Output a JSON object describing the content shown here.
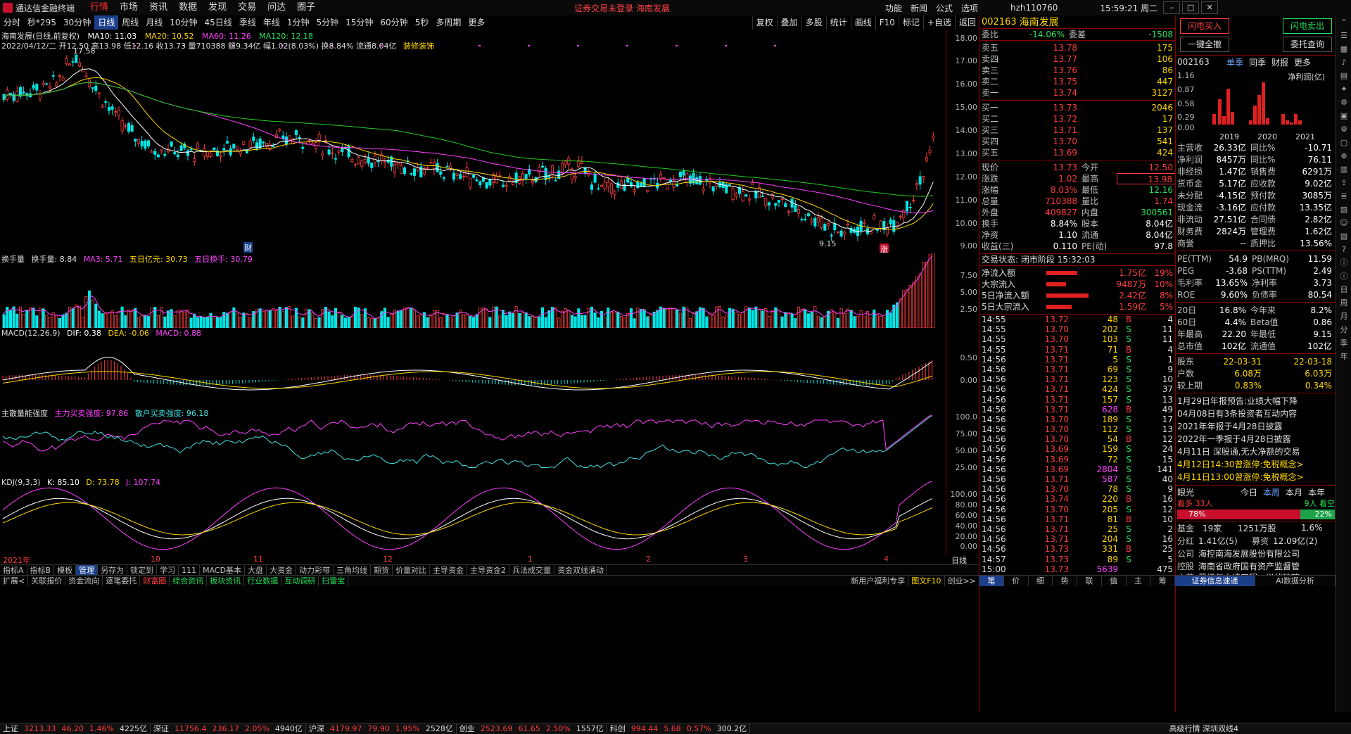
{
  "app": {
    "title": "通达信金融终端",
    "menu": [
      "行情",
      "市场",
      "资讯",
      "数据",
      "发现",
      "交易",
      "问达",
      "圈子"
    ],
    "active_menu": "行情",
    "notice": "证券交易未登录  海南发展",
    "right_menu": [
      "功能",
      "新闻",
      "公式",
      "选项"
    ],
    "user": "hzh110760",
    "time": "15:59:21 周二"
  },
  "periods": [
    "分时",
    "秒*295",
    "30分钟",
    "日线",
    "周线",
    "月线",
    "10分钟",
    "45日线",
    "季线",
    "年线",
    "1分钟",
    "5分钟",
    "15分钟",
    "60分钟",
    "5秒",
    "多周期",
    "更多"
  ],
  "active_period": "日线",
  "period_tools": [
    "复权",
    "叠加",
    "多股",
    "统计",
    "画线",
    "F10",
    "标记",
    "+自选",
    "返回"
  ],
  "price_panel": {
    "title": "海南发展(日线,前复权)",
    "ma10": "MA10: 11.03",
    "ma20": "MA20: 10.52",
    "ma60": "MA60: 11.26",
    "ma120": "MA120: 12.18",
    "info": "2022/04/12/二  开12.50 高13.98 低12.16 收13.73 量710388 额9.34亿 幅1.02(8.03%) 换8.84% 流通8.04亿",
    "sector": "装修装饰",
    "high_mark": "17.58",
    "low_mark": "9.15",
    "fin_mark": "财",
    "zhang_mark": "涨",
    "axis": [
      "18.00",
      "17.00",
      "16.00",
      "15.00",
      "14.00",
      "13.00",
      "12.00",
      "11.00",
      "10.00",
      "9.00"
    ]
  },
  "volume_panel": {
    "title": "换手量",
    "v1": "换手量: 8.84",
    "v2": "MA3: 5.71",
    "v3": "五日亿元: 30.73",
    "v4": "五日换手: 30.79",
    "axis": [
      "7.50",
      "5.00",
      "2.50"
    ]
  },
  "macd_panel": {
    "title": "MACD(12,26,9)",
    "dif": "DIF: 0.38",
    "dea": "DEA: -0.06",
    "macd": "MACD: 0.88",
    "axis": [
      "0.50",
      "0.00"
    ]
  },
  "strength_panel": {
    "title": "主散量能强度",
    "v1": "主力买卖强度: 97.86",
    "v2": "散户买卖强度: 96.18",
    "axis": [
      "100.0",
      "75.00",
      "50.00",
      "25.00"
    ]
  },
  "kdj_panel": {
    "title": "KDJ(9,3,3)",
    "k": "K: 85.10",
    "d": "D: 73.78",
    "j": "J: 107.74",
    "axis": [
      "100.00",
      "80.00",
      "60.00",
      "40.00",
      "20.00",
      "0.00"
    ]
  },
  "x_axis": {
    "labels": [
      "2021年",
      "10",
      "11",
      "12",
      "1",
      "2",
      "3",
      "4"
    ],
    "unit": "日线"
  },
  "quote": {
    "code": "002163",
    "name": "海南发展",
    "wb_label": "委比",
    "wb": "-14.06%",
    "wc_label": "委差",
    "wc": "-1508",
    "asks": [
      {
        "label": "卖五",
        "price": "13.78",
        "vol": "175"
      },
      {
        "label": "卖四",
        "price": "13.77",
        "vol": "106"
      },
      {
        "label": "卖三",
        "price": "13.76",
        "vol": "86"
      },
      {
        "label": "卖二",
        "price": "13.75",
        "vol": "447"
      },
      {
        "label": "卖一",
        "price": "13.74",
        "vol": "3127"
      }
    ],
    "bids": [
      {
        "label": "买一",
        "price": "13.73",
        "vol": "2046"
      },
      {
        "label": "买二",
        "price": "13.72",
        "vol": "17"
      },
      {
        "label": "买三",
        "price": "13.71",
        "vol": "137"
      },
      {
        "label": "买四",
        "price": "13.70",
        "vol": "541"
      },
      {
        "label": "买五",
        "price": "13.69",
        "vol": "424"
      }
    ],
    "stats": [
      {
        "l1": "现价",
        "v1": "13.73",
        "l2": "今开",
        "v2": "12.50"
      },
      {
        "l1": "涨跌",
        "v1": "1.02",
        "l2": "最高",
        "v2": "13.98"
      },
      {
        "l1": "涨幅",
        "v1": "8.03%",
        "l2": "最低",
        "v2": "12.16"
      },
      {
        "l1": "总量",
        "v1": "710388",
        "l2": "量比",
        "v2": "1.74"
      },
      {
        "l1": "外盘",
        "v1": "409827",
        "l2": "内盘",
        "v2": "300561"
      },
      {
        "l1": "换手",
        "v1": "8.84%",
        "l2": "股本",
        "v2": "8.04亿"
      },
      {
        "l1": "净资",
        "v1": "1.10",
        "l2": "流通",
        "v2": "8.04亿"
      },
      {
        "l1": "收益(三)",
        "v1": "0.110",
        "l2": "PE(动)",
        "v2": "97.8"
      }
    ],
    "trade_status": "交易状态: 闭市阶段 15:32:03",
    "flows": [
      {
        "label": "净流入额",
        "val": "1.75亿",
        "pct": "19%",
        "bar": 0.55
      },
      {
        "label": "大宗流入",
        "val": "9487万",
        "pct": "10%",
        "bar": 0.35
      },
      {
        "label": "5日净流入额",
        "val": "2.42亿",
        "pct": "8%",
        "bar": 0.75
      },
      {
        "label": "5日大宗流入",
        "val": "1.59亿",
        "pct": "5%",
        "bar": 0.45
      }
    ],
    "ticks": [
      {
        "t": "14:55",
        "p": "13.72",
        "v": "48",
        "s": "B",
        "n": "4"
      },
      {
        "t": "14:55",
        "p": "13.70",
        "v": "202",
        "s": "S",
        "n": "11"
      },
      {
        "t": "14:55",
        "p": "13.70",
        "v": "103",
        "s": "S",
        "n": "11"
      },
      {
        "t": "14:55",
        "p": "13.71",
        "v": "71",
        "s": "B",
        "n": "4"
      },
      {
        "t": "14:56",
        "p": "13.71",
        "v": "5",
        "s": "S",
        "n": "1"
      },
      {
        "t": "14:56",
        "p": "13.71",
        "v": "69",
        "s": "S",
        "n": "9"
      },
      {
        "t": "14:56",
        "p": "13.71",
        "v": "123",
        "s": "S",
        "n": "10"
      },
      {
        "t": "14:56",
        "p": "13.71",
        "v": "424",
        "s": "S",
        "n": "37"
      },
      {
        "t": "14:56",
        "p": "13.71",
        "v": "157",
        "s": "S",
        "n": "13"
      },
      {
        "t": "14:56",
        "p": "13.71",
        "v": "628",
        "s": "B",
        "n": "49"
      },
      {
        "t": "14:56",
        "p": "13.70",
        "v": "189",
        "s": "S",
        "n": "17"
      },
      {
        "t": "14:56",
        "p": "13.70",
        "v": "112",
        "s": "S",
        "n": "13"
      },
      {
        "t": "14:56",
        "p": "13.70",
        "v": "54",
        "s": "B",
        "n": "12"
      },
      {
        "t": "14:56",
        "p": "13.69",
        "v": "159",
        "s": "S",
        "n": "24"
      },
      {
        "t": "14:56",
        "p": "13.69",
        "v": "72",
        "s": "S",
        "n": "15"
      },
      {
        "t": "14:56",
        "p": "13.69",
        "v": "2804",
        "s": "S",
        "n": "141"
      },
      {
        "t": "14:56",
        "p": "13.71",
        "v": "587",
        "s": "S",
        "n": "40"
      },
      {
        "t": "14:56",
        "p": "13.70",
        "v": "78",
        "s": "S",
        "n": "9"
      },
      {
        "t": "14:56",
        "p": "13.74",
        "v": "220",
        "s": "B",
        "n": "16"
      },
      {
        "t": "14:56",
        "p": "13.70",
        "v": "205",
        "s": "S",
        "n": "12"
      },
      {
        "t": "14:56",
        "p": "13.71",
        "v": "81",
        "s": "B",
        "n": "10"
      },
      {
        "t": "14:56",
        "p": "13.71",
        "v": "25",
        "s": "S",
        "n": "2"
      },
      {
        "t": "14:56",
        "p": "13.71",
        "v": "204",
        "s": "S",
        "n": "16"
      },
      {
        "t": "14:56",
        "p": "13.73",
        "v": "331",
        "s": "B",
        "n": "25"
      },
      {
        "t": "14:57",
        "p": "13.73",
        "v": "89",
        "s": "S",
        "n": "5"
      },
      {
        "t": "15:00",
        "p": "13.73",
        "v": "5639",
        "s": "",
        "n": "475"
      }
    ]
  },
  "info": {
    "btn_buy": "闪电买入",
    "btn_sell": "闪电卖出",
    "btn_cancel": "一键全撤",
    "btn_query": "委托查询",
    "code": "002163",
    "tabs": [
      "单季",
      "同季",
      "财报",
      "更多"
    ],
    "chart_title": "净利润(亿)",
    "chart_axis": [
      "1.16",
      "0.87",
      "0.58",
      "0.29",
      "0.00"
    ],
    "chart_years": [
      "2019",
      "2020",
      "2021"
    ],
    "fin": [
      {
        "l1": "主营收",
        "v1": "26.33亿",
        "l2": "同比%",
        "v2": "-10.71"
      },
      {
        "l1": "净利润",
        "v1": "8457万",
        "l2": "同比%",
        "v2": "76.11"
      },
      {
        "l1": "非经损",
        "v1": "1.47亿",
        "l2": "销售费",
        "v2": "6291万"
      },
      {
        "l1": "货币金",
        "v1": "5.17亿",
        "l2": "应收款",
        "v2": "9.02亿"
      },
      {
        "l1": "未分配",
        "v1": "-4.15亿",
        "l2": "预付款",
        "v2": "3085万"
      },
      {
        "l1": "现金流",
        "v1": "-3.16亿",
        "l2": "应付款",
        "v2": "13.35亿"
      },
      {
        "l1": "非流动",
        "v1": "27.51亿",
        "l2": "合同债",
        "v2": "2.82亿"
      },
      {
        "l1": "财务费",
        "v1": "2824万",
        "l2": "管理费",
        "v2": "1.62亿"
      },
      {
        "l1": "商誉",
        "v1": "--",
        "l2": "质押比",
        "v2": "13.56%"
      }
    ],
    "val": [
      {
        "l1": "PE(TTM)",
        "v1": "54.9",
        "l2": "PB(MRQ)",
        "v2": "11.59"
      },
      {
        "l1": "PEG",
        "v1": "-3.68",
        "l2": "PS(TTM)",
        "v2": "2.49"
      },
      {
        "l1": "毛利率",
        "v1": "13.65%",
        "l2": "净利率",
        "v2": "3.73"
      },
      {
        "l1": "ROE",
        "v1": "9.60%",
        "l2": "负债率",
        "v2": "80.54"
      }
    ],
    "perf": [
      {
        "l1": "20日",
        "v1": "16.8%",
        "l2": "今年来",
        "v2": "8.2%"
      },
      {
        "l1": "60日",
        "v1": "4.4%",
        "l2": "Beta值",
        "v2": "0.86"
      },
      {
        "l1": "年最高",
        "v1": "22.20",
        "l2": "年最低",
        "v2": "9.15"
      },
      {
        "l1": "总市值",
        "v1": "102亿",
        "l2": "流通值",
        "v2": "102亿"
      }
    ],
    "holders": [
      {
        "l1": "股东",
        "v1": "22-03-31",
        "v2": "22-03-18"
      },
      {
        "l1": "户数",
        "v1": "6.08万",
        "v2": "6.03万"
      },
      {
        "l1": "较上期",
        "v1": "0.83%",
        "v2": "0.34%"
      }
    ],
    "news": [
      "1月29日年报预告:业绩大幅下降",
      "04月08日有3条投资者互动内容",
      "2021年年报于4月28日披露",
      "2022年一季报于4月28日披露",
      "4月11日 深股通,无大净额的交易",
      "4月12日14:30曾涨停:免税概念>",
      "4月11日13:00曾涨停:免税概念>"
    ],
    "eye_label": "眼光",
    "eye_tabs": [
      "今日",
      "本周",
      "本月",
      "本年"
    ],
    "kan_zhang": "看多 33人",
    "kan_die": "9人 看空",
    "bull_pct": "78%",
    "bear_pct": "22%",
    "bull_frac": 0.78,
    "fund_label": "基金",
    "fund": "19家",
    "fund_shares": "1251万股",
    "fund_pct": "1.6%",
    "red_label": "分红",
    "red_val": "1.41亿(5)",
    "raise_label": "募资",
    "raise_val": "12.09亿(2)",
    "company_label": "公司",
    "company": "海控南海发展股份有限公司",
    "ctrl_label": "控股",
    "ctrl": "海南省政府国有资产监督管",
    "biz_label": "主营",
    "biz": "幕墙与内墙工程、光伏玻璃"
  },
  "bottom_tabs1": [
    "指标A",
    "指标B",
    "模板",
    "管理",
    "另存为",
    "锁定到",
    "学习",
    "111",
    "MACD基本",
    "大盘",
    "大资金",
    "动力彩带",
    "三角均线",
    "期货",
    "价量对比",
    "主导资金",
    "主导资金2",
    "兵法成交量",
    "资金双线涌动"
  ],
  "bottom_tabs2": [
    "扩展<",
    "关联报价",
    "资金流向",
    "逐笔委托",
    "财富圈",
    "综合资讯",
    "板块资讯",
    "行业数据",
    "互动调研",
    "扫雷宝"
  ],
  "bottom_right": [
    "新用户福利专享",
    "图文F10",
    "创业>>"
  ],
  "quote_tabs": [
    "笔",
    "价",
    "细",
    "势",
    "联",
    "值",
    "主",
    "筹"
  ],
  "info_tabs": [
    "证券信息速递",
    "AI数据分析"
  ],
  "status": [
    {
      "name": "上证",
      "val": "3213.33",
      "chg": "46.20",
      "pct": "1.46%",
      "amt": "4225亿"
    },
    {
      "name": "深证",
      "val": "11756.4",
      "chg": "236.17",
      "pct": "2.05%",
      "amt": "4940亿"
    },
    {
      "name": "沪深",
      "val": "4179.97",
      "chg": "79.90",
      "pct": "1.95%",
      "amt": "2528亿"
    },
    {
      "name": "创业",
      "val": "2523.69",
      "chg": "61.65",
      "pct": "2.50%",
      "amt": "1557亿"
    },
    {
      "name": "科创",
      "val": "994.44",
      "chg": "5.68",
      "pct": "0.57%",
      "amt": "300.2亿"
    }
  ],
  "status_right": "高级行情 深圳双线4",
  "side_icons": [
    "up-arrow",
    "list",
    "grid",
    "bell",
    "chart",
    "tools",
    "settings",
    "news",
    "gear",
    "code",
    "magnet",
    "data",
    "export",
    "stack",
    "book",
    "person",
    "folder",
    "question",
    "info",
    "info"
  ],
  "side_text": [
    "日",
    "周",
    "月",
    "分",
    "季",
    "年"
  ],
  "colors": {
    "up": "#ff3b3b",
    "down": "#27e05a",
    "ma10": "#ffffff",
    "ma20": "#ffd700",
    "ma60": "#ff40ff",
    "ma120": "#22cc22",
    "accent": "#1c3f8a"
  }
}
